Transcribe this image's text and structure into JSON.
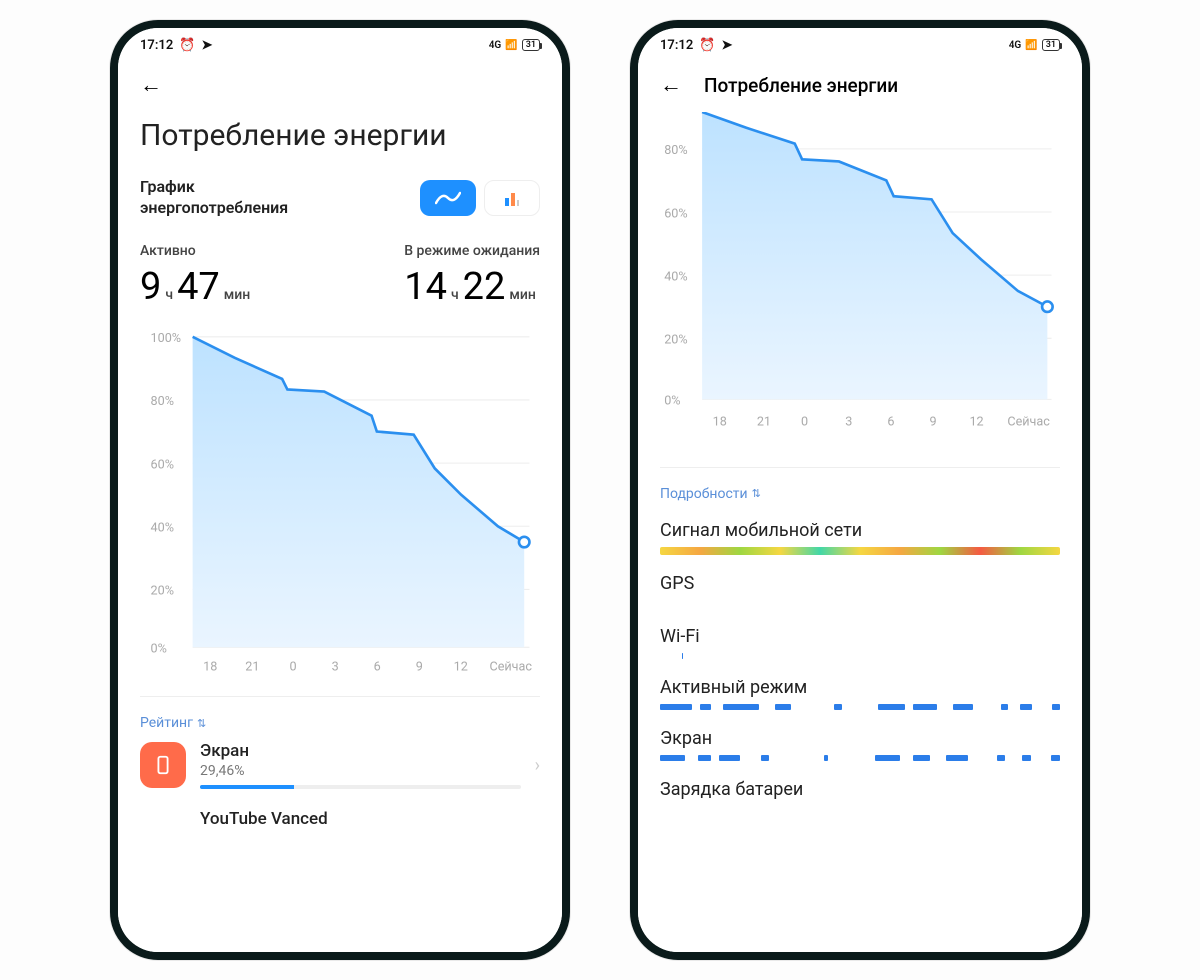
{
  "status": {
    "time": "17:12",
    "battery": "31",
    "network_tag": "4G"
  },
  "left": {
    "page_title": "Потребление энергии",
    "chart_label": "График энергопотребления",
    "active_label": "Активно",
    "active_h": "9",
    "active_h_unit": "ч",
    "active_m": "47",
    "active_m_unit": "мин",
    "standby_label": "В режиме ожидания",
    "standby_h": "14",
    "standby_h_unit": "ч",
    "standby_m": "22",
    "standby_m_unit": "мин",
    "rating_label": "Рейтинг",
    "app1_name": "Экран",
    "app1_pct": "29,46%",
    "app2_name": "YouTube Vanced"
  },
  "right": {
    "page_title": "Потребление энергии",
    "details_label": "Подробности",
    "rows": {
      "cell": "Сигнал мобильной сети",
      "gps": "GPS",
      "wifi": "Wi-Fi",
      "active": "Активный режим",
      "screen": "Экран",
      "charging": "Зарядка батареи"
    }
  },
  "chart_axes": {
    "y": [
      "100%",
      "80%",
      "60%",
      "40%",
      "20%",
      "0%"
    ],
    "x": [
      "18",
      "21",
      "0",
      "3",
      "6",
      "9",
      "12",
      "Сейчас"
    ]
  },
  "chart_data": {
    "type": "area",
    "title": "График энергопотребления",
    "xlabel": "",
    "ylabel": "",
    "ylim": [
      0,
      100
    ],
    "categories": [
      "18",
      "21",
      "0",
      "3",
      "6",
      "9",
      "12",
      "Сейчас"
    ],
    "values": [
      100,
      92,
      83,
      76,
      70,
      58,
      50,
      34
    ]
  }
}
